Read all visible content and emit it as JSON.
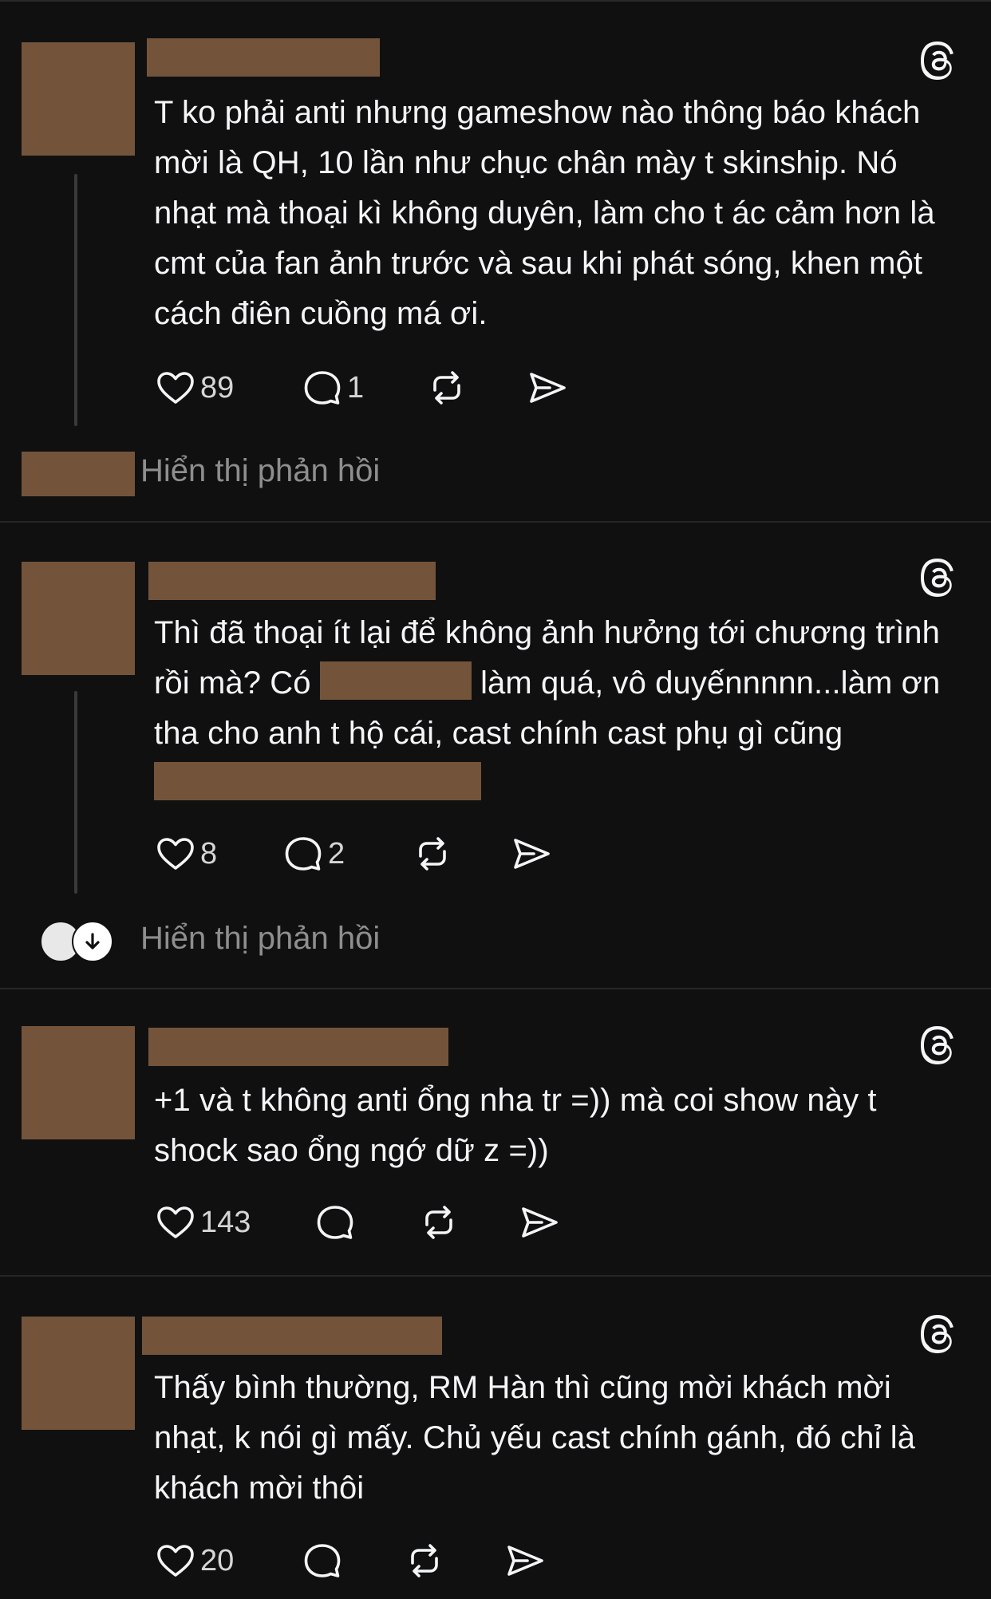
{
  "colors": {
    "background": "#101010",
    "text": "#f3f5f7",
    "muted": "#8e8e8e",
    "redaction": "#73543b"
  },
  "icons": {
    "like": "heart-icon",
    "reply": "comment-icon",
    "repost": "repost-icon",
    "share": "send-icon",
    "brand": "threads-icon"
  },
  "posts": [
    {
      "text": "T ko phải anti nhưng gameshow nào thông báo khách mời là QH, 10 lần như chục chân mày t skinship. Nó nhạt mà thoại kì không duyên, làm cho t ác cảm hơn là cmt của fan ảnh trước và sau khi phát sóng, khen một cách điên cuồng má ơi.",
      "likes": "89",
      "replies": "1",
      "show_replies": "Hiển thị phản hồi"
    },
    {
      "text_a": "Thì đã thoại ít lại để không ảnh hưởng tới chương trình rồi mà? Có",
      "text_b": "làm quá, vô duyếnnnnn...làm ơn tha cho anh t hộ cái, cast chính cast phụ gì cũng",
      "likes": "8",
      "replies": "2",
      "show_replies": "Hiển thị phản hồi"
    },
    {
      "text": "+1 và t không anti ổng nha tr =)) mà coi show này t shock sao ổng ngớ dữ z =))",
      "likes": "143"
    },
    {
      "text": "Thấy bình thường, RM Hàn thì cũng mời khách mời nhạt, k nói gì mấy. Chủ yếu cast chính gánh, đó chỉ là khách mời thôi",
      "likes": "20"
    }
  ]
}
